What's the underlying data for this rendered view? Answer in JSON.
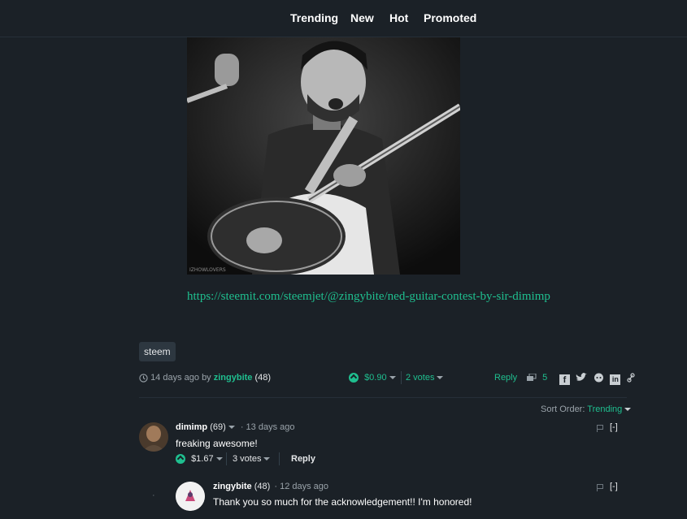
{
  "nav": {
    "items": [
      {
        "label": "Trending"
      },
      {
        "label": "New"
      },
      {
        "label": "Hot"
      },
      {
        "label": "Promoted"
      }
    ]
  },
  "post": {
    "image_caption": "IZHOWLOVERS",
    "link": "https://steemit.com/steemjet/@zingybite/ned-guitar-contest-by-sir-dimimp",
    "tag": "steem",
    "time": "14 days ago",
    "by": "by",
    "author": "zingybite",
    "author_rep": "(48)",
    "payout": "$0.90",
    "votes": "2 votes",
    "reply_label": "Reply",
    "comment_count": "5"
  },
  "comments": {
    "sort_label": "Sort Order:",
    "sort_value": "Trending",
    "items": [
      {
        "author": "dimimp",
        "rep": "(69)",
        "time": "13 days ago",
        "body": "freaking awesome!",
        "payout": "$1.67",
        "votes": "3 votes",
        "reply_label": "Reply",
        "collapse": "[-]"
      },
      {
        "author": "zingybite",
        "rep": "(48)",
        "time": "12 days ago",
        "body": "Thank you so much for the acknowledgement!! I'm honored!",
        "collapse": "[-]"
      }
    ]
  },
  "colors": {
    "accent": "#1fbf8f",
    "background": "#1b2127"
  }
}
